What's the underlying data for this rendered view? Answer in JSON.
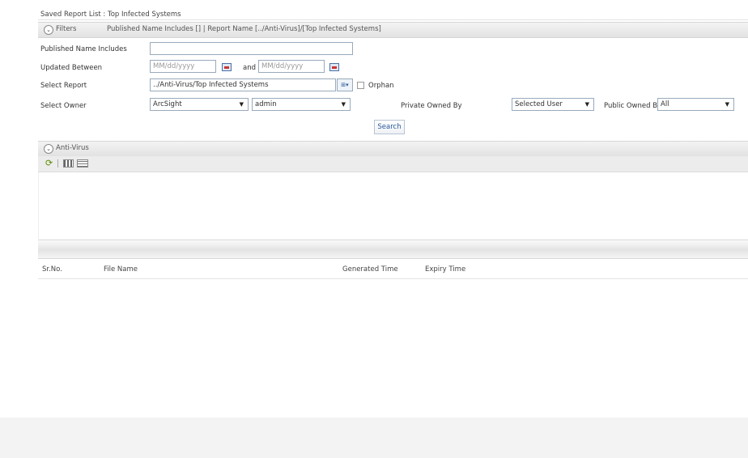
{
  "breadcrumb": "Saved Report List : Top Infected Systems",
  "filters": {
    "title": "Filters",
    "summary": "Published Name Includes [] | Report Name [../Anti-Virus]/[Top Infected Systems]",
    "published_name_label": "Published Name Includes",
    "published_name_value": "",
    "updated_between_label": "Updated Between",
    "date_from_placeholder": "MM/dd/yyyy",
    "and_label": "and",
    "date_to_placeholder": "MM/dd/yyyy",
    "select_report_label": "Select Report",
    "select_report_value": "../Anti-Virus/Top Infected Systems",
    "orphan_label": "Orphan",
    "select_owner_label": "Select Owner",
    "owner_group": "ArcSight",
    "owner_user": "admin",
    "private_owned_by_label": "Private Owned By",
    "private_owned_by_value": "Selected User",
    "public_owned_by_label": "Public Owned By",
    "public_owned_by_value": "All",
    "search_button": "Search"
  },
  "results": {
    "title": "Anti-Virus",
    "columns": [
      "Sr.No.",
      "File Name",
      "Generated Time",
      "Expiry Time"
    ]
  },
  "icons": {
    "collapse": "collapse-icon",
    "calendar": "calendar-icon",
    "report_picker": "tree-picker-icon",
    "refresh": "refresh-icon",
    "grid_view": "grid-view-icon",
    "list_view": "list-view-icon"
  }
}
